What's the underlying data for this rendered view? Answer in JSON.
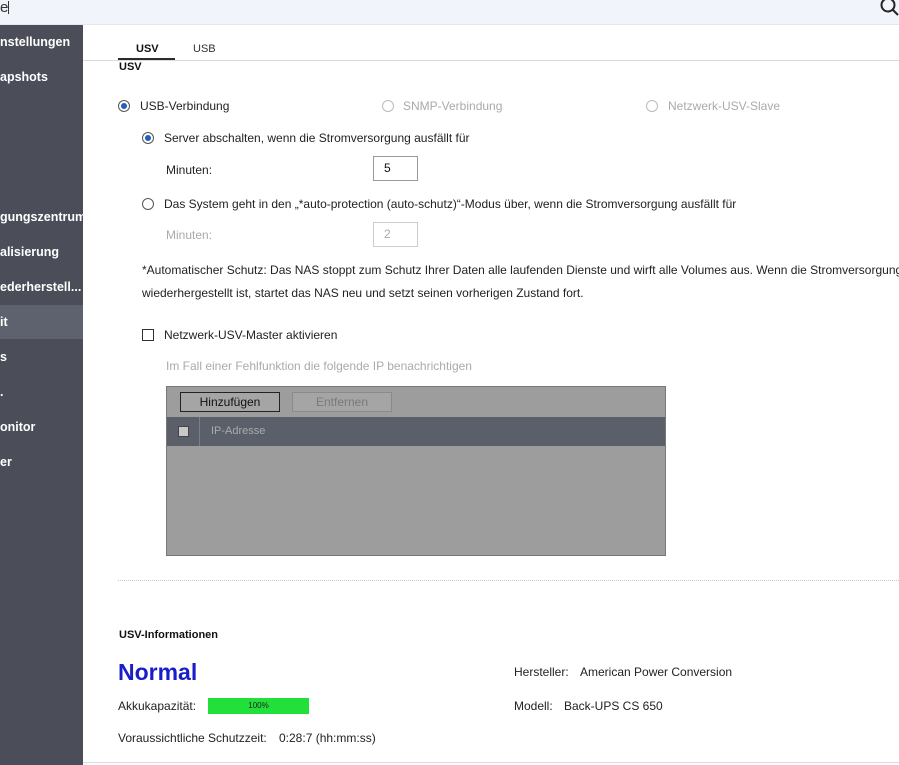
{
  "search": {
    "value": "e"
  },
  "sidebar": {
    "items": [
      {
        "label": "nstellungen"
      },
      {
        "label": "apshots"
      },
      {
        "label": "gungszentrum"
      },
      {
        "label": "alisierung"
      },
      {
        "label": "ederherstell..."
      },
      {
        "label": "it"
      },
      {
        "label": "s"
      },
      {
        "label": "."
      },
      {
        "label": "onitor"
      },
      {
        "label": "er"
      }
    ]
  },
  "tabs": [
    {
      "label": "USV"
    },
    {
      "label": "USB"
    }
  ],
  "ups": {
    "section_title": "USV",
    "connection": {
      "usb": "USB-Verbindung",
      "snmp": "SNMP-Verbindung",
      "slave": "Netzwerk-USV-Slave"
    },
    "shutdown": {
      "label": "Server abschalten, wenn die Stromversorgung ausfällt für",
      "minutes_label": "Minuten:",
      "minutes_value": "5"
    },
    "autoprotect": {
      "label": "Das System geht in den „*auto-protection (auto-schutz)“-Modus über, wenn die Stromversorgung ausfällt für",
      "minutes_label": "Minuten:",
      "minutes_value": "2"
    },
    "note_line1": "*Automatischer Schutz: Das NAS stoppt zum Schutz Ihrer Daten alle laufenden Dienste und wirft alle Volumes aus. Wenn die Stromversorgung",
    "note_line2": "wiederhergestellt ist, startet das NAS neu und setzt seinen vorherigen Zustand fort.",
    "master": {
      "label": "Netzwerk-USV-Master aktivieren",
      "notify_label": "Im Fall einer Fehlfunktion die folgende IP benachrichtigen",
      "add_button": "Hinzufügen",
      "remove_button": "Entfernen",
      "column_ip": "IP-Adresse"
    }
  },
  "info": {
    "title": "USV-Informationen",
    "status": "Normal",
    "battery_label": "Akkukapazität:",
    "battery_percent": "100%",
    "battery_fraction": 1.0,
    "runtime_label": "Voraussichtliche Schutzzeit:",
    "runtime_value": "0:28:7 (hh:mm:ss)",
    "manufacturer_label": "Hersteller:",
    "manufacturer_value": "American Power Conversion",
    "model_label": "Modell:",
    "model_value": "Back-UPS CS 650"
  },
  "colors": {
    "status": "#1a1ec8",
    "battery": "#22e03a",
    "sidebar": "#4b4e59"
  }
}
